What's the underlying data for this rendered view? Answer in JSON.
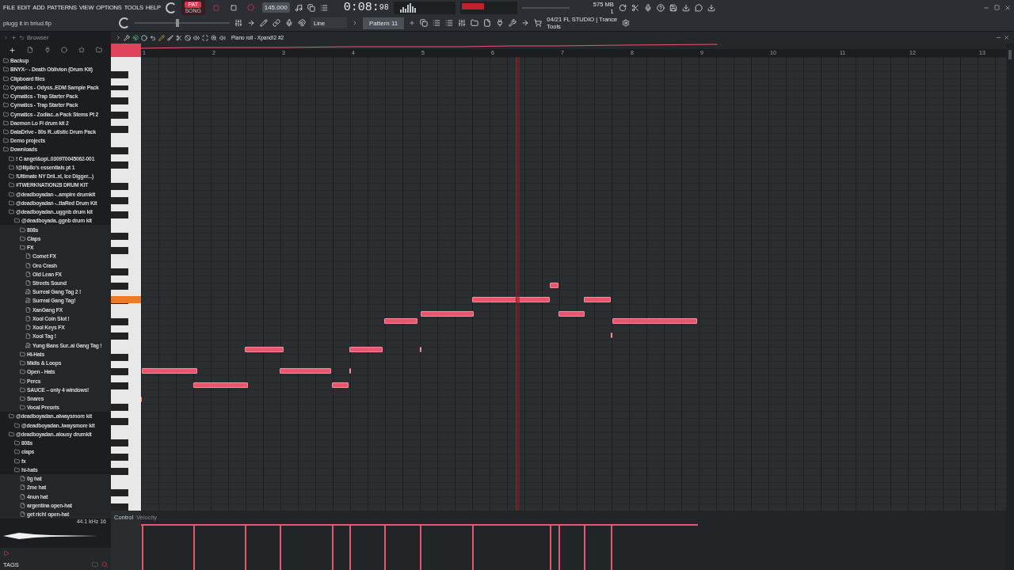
{
  "menu": [
    "FILE",
    "EDIT",
    "ADD",
    "PATTERNS",
    "VIEW",
    "OPTIONS",
    "TOOLS",
    "HELP"
  ],
  "transport": {
    "pattern_label": "PAT",
    "song_label": "SONG",
    "tempo": "145.000",
    "time": "0:08:",
    "time_cs": "98",
    "memory": "575 MB",
    "voices": "1"
  },
  "hint": "plugg it in brlud.flp",
  "master_pitch": {
    "level": 0.45
  },
  "snap": "Line",
  "pattern": "Pattern 11",
  "news": {
    "date": "04/21",
    "title": "FL STUDIO | Trance",
    "subtitle": "Tools"
  },
  "browser": {
    "title": "Browser",
    "tree": [
      {
        "label": "Backup",
        "kind": "folder"
      },
      {
        "label": "BNYX⌐ - Death Oblivion (Drum Kit)",
        "kind": "folder"
      },
      {
        "label": "Clipboard files",
        "kind": "folder"
      },
      {
        "label": "Cymatics - Odyss..EDM Sample Pack",
        "kind": "folder"
      },
      {
        "label": "Cymatics - Trap Starter Pack",
        "kind": "folder"
      },
      {
        "label": "Cymatics - Trap Starter Pack",
        "kind": "folder"
      },
      {
        "label": "Cymatics - Zodiac..a Pack Stems Pt 2",
        "kind": "folder"
      },
      {
        "label": "Daemon Lo Fi drum kit 2",
        "kind": "folder"
      },
      {
        "label": "DataDrive - 80s R..utistic Drum Pack",
        "kind": "folder"
      },
      {
        "label": "Demo projects",
        "kind": "folder"
      },
      {
        "label": "Downloads",
        "kind": "folder",
        "children": [
          {
            "label": "! Ϲ angel&opi..0309T0045062-001",
            "kind": "folder"
          },
          {
            "label": "!@lilp8o's essentials pt 1",
            "kind": "folder"
          },
          {
            "label": "!Ultimate NY Dril..xl, Ice Digger...)",
            "kind": "folder"
          },
          {
            "label": "#TWERKNATION28 DRUM KIT",
            "kind": "folder"
          },
          {
            "label": "@deadboyadan -..ampire drumkit",
            "kind": "folder"
          },
          {
            "label": "@deadboyadan -..ttaRed Drum Kit",
            "kind": "folder"
          },
          {
            "label": "@deadboyadan..uggnb drum kit",
            "kind": "folder",
            "children": [
              {
                "label": "@deadboyada..ggnb drum kit",
                "kind": "folder",
                "children": [
                  {
                    "label": "808s",
                    "kind": "folder"
                  },
                  {
                    "label": "Claps",
                    "kind": "folder"
                  },
                  {
                    "label": "FX",
                    "kind": "folder",
                    "children": [
                      {
                        "label": "Comet FX",
                        "kind": "file"
                      },
                      {
                        "label": "Oro Crash",
                        "kind": "file"
                      },
                      {
                        "label": "Old Lean FX",
                        "kind": "file"
                      },
                      {
                        "label": "Streets Sound",
                        "kind": "file"
                      },
                      {
                        "label": "Surreal Gang Tag 2 !",
                        "kind": "audio"
                      },
                      {
                        "label": "Surreal Gang Tag!",
                        "kind": "audio"
                      },
                      {
                        "label": "XanGang FX",
                        "kind": "file"
                      },
                      {
                        "label": "Xool Coin Slot !",
                        "kind": "file"
                      },
                      {
                        "label": "Xool Keys FX",
                        "kind": "file"
                      },
                      {
                        "label": "Xool Tag !",
                        "kind": "file"
                      },
                      {
                        "label": "Yung Bans Sur..al Gang Tag !",
                        "kind": "audio"
                      }
                    ]
                  },
                  {
                    "label": "Hi-Hats",
                    "kind": "folder"
                  },
                  {
                    "label": "Midis & Loops",
                    "kind": "folder"
                  },
                  {
                    "label": "Open - Hats",
                    "kind": "folder"
                  },
                  {
                    "label": "Percs",
                    "kind": "folder"
                  },
                  {
                    "label": "SAUCE – only 4 windows!",
                    "kind": "folder"
                  },
                  {
                    "label": "Snares",
                    "kind": "folder"
                  },
                  {
                    "label": "Vocal Presets",
                    "kind": "folder"
                  }
                ]
              }
            ]
          },
          {
            "label": "@deadboyadan..alwaysmore kit",
            "kind": "folder",
            "children": [
              {
                "label": "@deadboyadan..lwaysmore kit",
                "kind": "folder"
              }
            ]
          },
          {
            "label": "@deadboyadan..alousy drumkit",
            "kind": "folder",
            "children": [
              {
                "label": "808s",
                "kind": "folder"
              },
              {
                "label": "claps",
                "kind": "folder"
              },
              {
                "label": "fx",
                "kind": "folder"
              },
              {
                "label": "hi-hats",
                "kind": "folder",
                "children": [
                  {
                    "label": "0g hat",
                    "kind": "file"
                  },
                  {
                    "label": "2me hat",
                    "kind": "file"
                  },
                  {
                    "label": "4nun hat",
                    "kind": "file"
                  },
                  {
                    "label": "argentina open-hat",
                    "kind": "file"
                  },
                  {
                    "label": "get rich! open-hat",
                    "kind": "file"
                  }
                ]
              }
            ]
          }
        ]
      }
    ],
    "sample_info": "44.1 kHz 16",
    "tags_label": "TAGS"
  },
  "piano_roll": {
    "title": "Piano roll - Xpand!2 #2",
    "bars": [
      "1",
      "2",
      "3",
      "4",
      "5",
      "6",
      "7",
      "8",
      "9",
      "10",
      "11",
      "12",
      "13"
    ],
    "control_label": "Control",
    "control_target": "Velocity"
  }
}
